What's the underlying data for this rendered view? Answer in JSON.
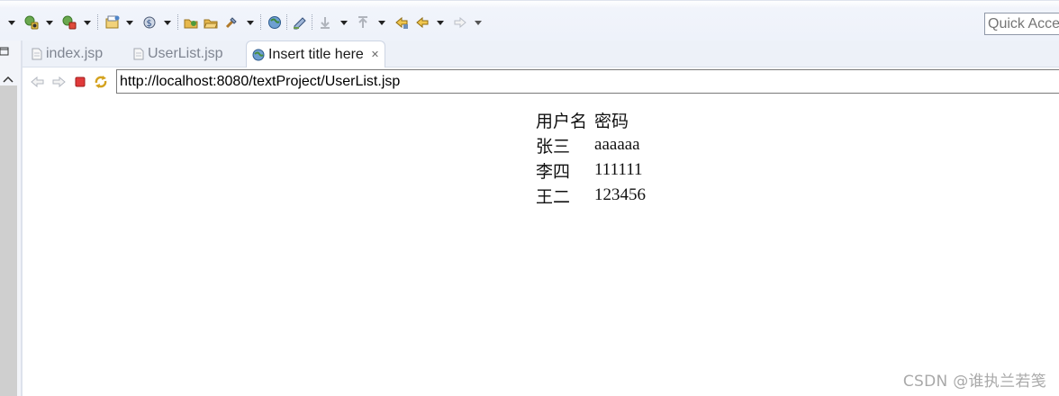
{
  "toolbar": {
    "quick_access_placeholder": "Quick Access",
    "icons": [
      "dropdown-arrow-icon",
      "run-icon",
      "dropdown-arrow-icon",
      "stop-server-icon",
      "dropdown-arrow-icon",
      "new-wizard-icon",
      "dropdown-arrow-icon",
      "server-icon",
      "dropdown-arrow-icon",
      "open-type-icon",
      "open-resource-icon",
      "search-icon",
      "dropdown-arrow-icon",
      "web-browser-icon",
      "annotation-icon",
      "next-annotation-icon",
      "dropdown-arrow-icon",
      "previous-annotation-icon",
      "dropdown-arrow-icon",
      "last-edit-location-icon",
      "back-icon",
      "dropdown-arrow-icon",
      "forward-icon",
      "dropdown-arrow-icon"
    ]
  },
  "tabs": [
    {
      "label": "index.jsp",
      "icon": "jsp-file-icon",
      "active": false
    },
    {
      "label": "UserList.jsp",
      "icon": "jsp-file-icon",
      "active": false
    },
    {
      "label": "Insert title here",
      "icon": "globe-icon",
      "active": true,
      "close": "✕"
    }
  ],
  "browser": {
    "url": "http://localhost:8080/textProject/UserList.jsp",
    "buttons": [
      "back-icon",
      "forward-icon",
      "stop-icon",
      "refresh-icon"
    ]
  },
  "page": {
    "headers": [
      "用户名",
      "密码"
    ],
    "rows": [
      [
        "张三",
        "aaaaaa"
      ],
      [
        "李四",
        "111111"
      ],
      [
        "王二",
        "123456"
      ]
    ]
  },
  "watermark": "CSDN @谁执兰若笺",
  "colors": {
    "accent_red": "#e03a3a",
    "toolbar_bg": "#eef2fa",
    "tab_active_bg": "#ffffff"
  }
}
